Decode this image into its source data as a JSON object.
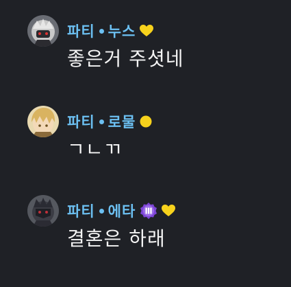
{
  "messages": [
    {
      "party": "파티",
      "nickname": "누스",
      "badges": [
        "yellow-heart-icon"
      ],
      "text": "좋은거 주셧네"
    },
    {
      "party": "파티",
      "nickname": "로물",
      "badges": [
        "yellow-circle-icon"
      ],
      "text": "ㄱㄴㄲ"
    },
    {
      "party": "파티",
      "nickname": "에타",
      "badges": [
        "purple-roman-three-badge-icon",
        "yellow-heart-icon"
      ],
      "badge_text": "Ⅲ",
      "text": "결혼은 하래"
    }
  ],
  "colors": {
    "background": "#1f2126",
    "name": "#6cc0f2",
    "message": "#f4f4f4",
    "badge_yellow": "#f7d21c",
    "badge_purple": "#7d45d6"
  }
}
